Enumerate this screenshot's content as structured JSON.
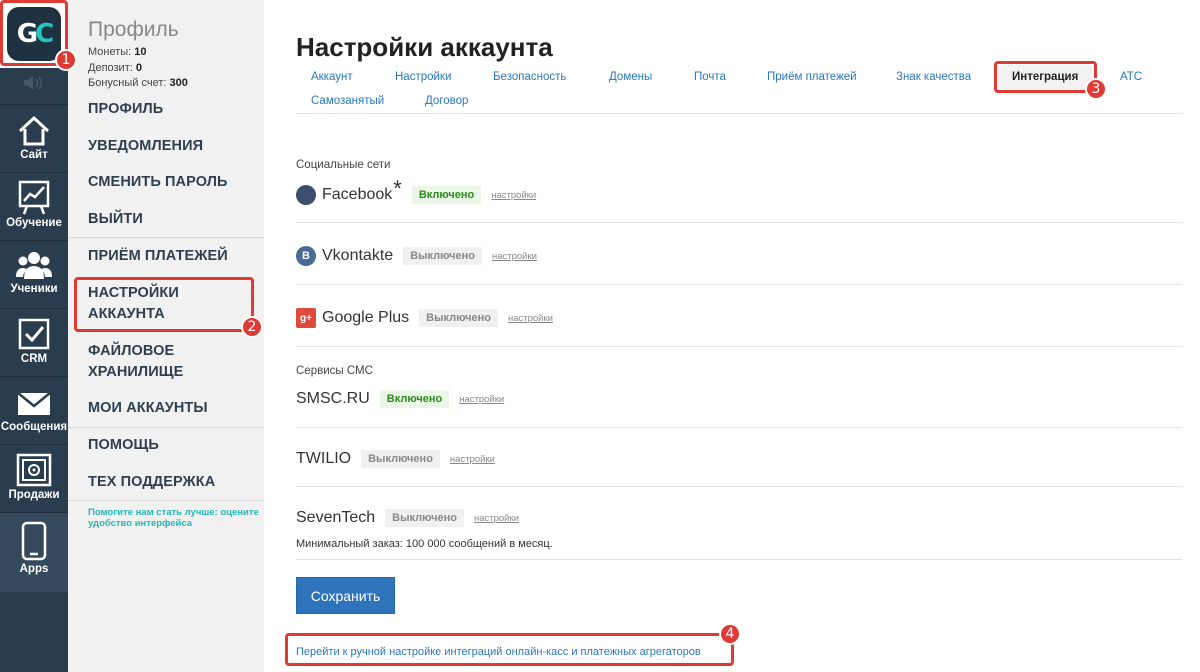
{
  "logo": {
    "text_g": "G",
    "text_c": "C"
  },
  "rail": [
    {
      "label": "Сайт",
      "icon": "home-icon"
    },
    {
      "label": "Обучение",
      "icon": "chart-board-icon"
    },
    {
      "label": "Ученики",
      "icon": "users-icon"
    },
    {
      "label": "CRM",
      "icon": "checkbox-icon"
    },
    {
      "label": "Сообщения",
      "icon": "envelope-icon"
    },
    {
      "label": "Продажи",
      "icon": "safe-icon"
    },
    {
      "label": "Apps",
      "icon": "phone-icon"
    }
  ],
  "profile": {
    "title": "Профиль",
    "coins_label": "Монеты:",
    "coins_value": "10",
    "deposit_label": "Депозит:",
    "deposit_value": "0",
    "bonus_label": "Бонусный счет:",
    "bonus_value": "300"
  },
  "menu": [
    "Профиль",
    "Уведомления",
    "Сменить пароль",
    "Выйти",
    "Приём платежей",
    "Настройки аккаунта",
    "Файловое хранилище",
    "Мои аккаунты",
    "Помощь",
    "Тех поддержка"
  ],
  "feedback": "Помогите нам стать лучше: оцените удобство интерфейса",
  "page_title": "Настройки аккаунта",
  "tabs": [
    "Аккаунт",
    "Настройки",
    "Безопасность",
    "Домены",
    "Почта",
    "Приём платежей",
    "Знак качества",
    "Интеграция",
    "АТС",
    "Самозанятый",
    "Договор"
  ],
  "active_tab": "Интеграция",
  "sections": {
    "social": "Социальные сети",
    "sms": "Сервисы СМС"
  },
  "services": [
    {
      "name": "Facebook",
      "status": "Включено",
      "link": "настройки",
      "star": "*"
    },
    {
      "name": "Vkontakte",
      "status": "Выключено",
      "link": "настройки"
    },
    {
      "name": "Google Plus",
      "status": "Выключено",
      "link": "настройки"
    },
    {
      "name": "SMSC.RU",
      "status": "Включено",
      "link": "настройки"
    },
    {
      "name": "TWILIO",
      "status": "Выключено",
      "link": "настройки"
    },
    {
      "name": "SevenTech",
      "status": "Выключено",
      "link": "настройки"
    }
  ],
  "seventech_note": "Минимальный заказ: 100 000 сообщений в месяц.",
  "save_label": "Сохранить",
  "manual_link": "Перейти к ручной настройке интеграций онлайн-касс и платежных агрегаторов",
  "markers": [
    "1",
    "2",
    "3",
    "4"
  ],
  "colors": {
    "accent": "#2f74bb",
    "highlight": "#e03a34",
    "rail": "#2a3d4f",
    "enabled": "#2c8a1d"
  }
}
